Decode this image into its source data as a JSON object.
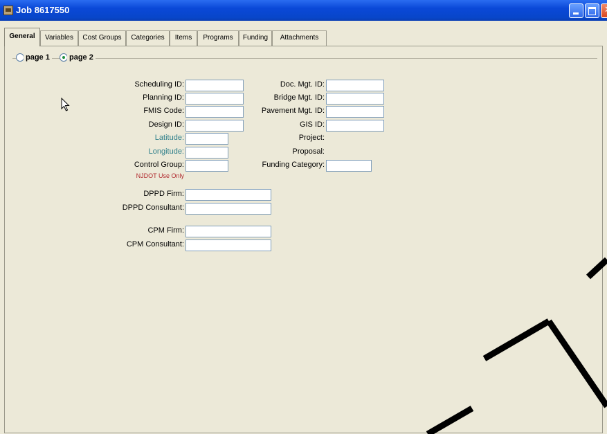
{
  "window": {
    "title": "Job 8617550"
  },
  "tabs": [
    {
      "label": "General"
    },
    {
      "label": "Variables"
    },
    {
      "label": "Cost Groups"
    },
    {
      "label": "Categories"
    },
    {
      "label": "Items"
    },
    {
      "label": "Programs"
    },
    {
      "label": "Funding"
    },
    {
      "label": "Attachments"
    }
  ],
  "pages": {
    "page1": "page 1",
    "page2": "page 2",
    "selected": "page 2"
  },
  "left_form": {
    "scheduling_id": {
      "label": "Scheduling ID:",
      "value": ""
    },
    "planning_id": {
      "label": "Planning ID:",
      "value": ""
    },
    "fmis_code": {
      "label": "FMIS Code:",
      "value": ""
    },
    "design_id": {
      "label": "Design ID:",
      "value": ""
    },
    "latitude": {
      "label": "Latitude:",
      "value": ""
    },
    "longitude": {
      "label": "Longitude:",
      "value": ""
    },
    "control_group": {
      "label": "Control Group:",
      "value": ""
    },
    "njdot_note": "NJDOT Use Only",
    "dppd_firm": {
      "label": "DPPD Firm:",
      "value": ""
    },
    "dppd_consultant": {
      "label": "DPPD Consultant:",
      "value": ""
    },
    "cpm_firm": {
      "label": "CPM Firm:",
      "value": ""
    },
    "cpm_consultant": {
      "label": "CPM Consultant:",
      "value": ""
    }
  },
  "right_form": {
    "doc_mgt_id": {
      "label": "Doc. Mgt. ID:",
      "value": ""
    },
    "bridge_mgt_id": {
      "label": "Bridge Mgt. ID:",
      "value": ""
    },
    "pavement_mgt_id": {
      "label": "Pavement Mgt. ID:",
      "value": ""
    },
    "gis_id": {
      "label": "GIS ID:",
      "value": ""
    },
    "project": {
      "label": "Project:"
    },
    "proposal": {
      "label": "Proposal:"
    },
    "funding_category": {
      "label": "Funding Category:",
      "value": ""
    }
  },
  "colors": {
    "titlebar": "#0a48d8",
    "background": "#ece9d8",
    "teal_label": "#2e7f8a",
    "red_note": "#b0282d"
  }
}
